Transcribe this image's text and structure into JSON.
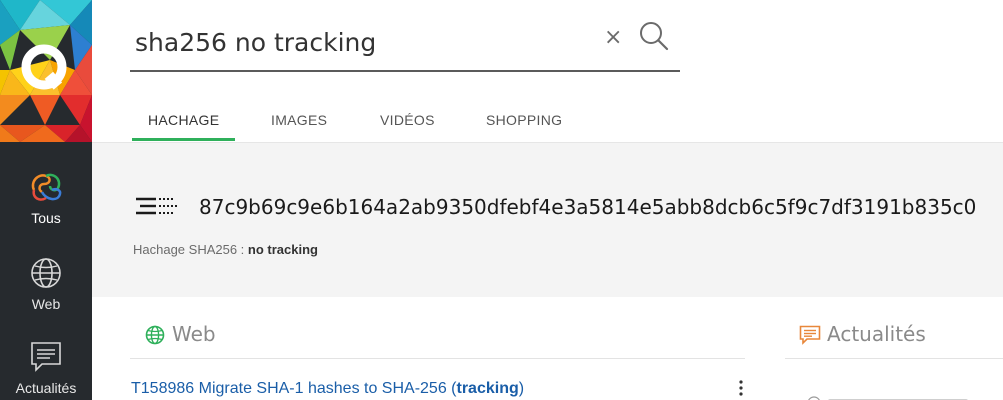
{
  "search": {
    "query": "sha256 no tracking",
    "clear_glyph": "×",
    "search_icon": "magnifier-icon"
  },
  "sidebar": {
    "logo_icon": "qwant-q-logo",
    "items": [
      {
        "label": "Tous",
        "icon": "all-blob-icon"
      },
      {
        "label": "Web",
        "icon": "globe-icon"
      },
      {
        "label": "Actualités",
        "icon": "news-icon"
      }
    ]
  },
  "tabs": [
    {
      "label": "HACHAGE",
      "active": true
    },
    {
      "label": "IMAGES"
    },
    {
      "label": "VIDÉOS"
    },
    {
      "label": "SHOPPING"
    }
  ],
  "hash": {
    "icon": "hash-lines-icon",
    "value": "87c9b69c9e6b164a2ab9350dfebf4e3a5814e5abb8dcb6c5f9c7df3191b835c0",
    "caption_prefix": "Hachage SHA256 : ",
    "caption_value": "no tracking"
  },
  "sections": {
    "web": {
      "title": "Web",
      "icon": "globe-icon"
    },
    "news": {
      "title": "Actualités",
      "icon": "news-icon"
    }
  },
  "result": {
    "text_before": "T158986 Migrate SHA-1 hashes to SHA-256 (",
    "highlight": "tracking",
    "text_after": ")"
  },
  "colors": {
    "accent_green": "#2fb05b",
    "news_orange": "#e8873a",
    "link_blue": "#1a5ea8",
    "rail_bg": "#262a2e"
  }
}
